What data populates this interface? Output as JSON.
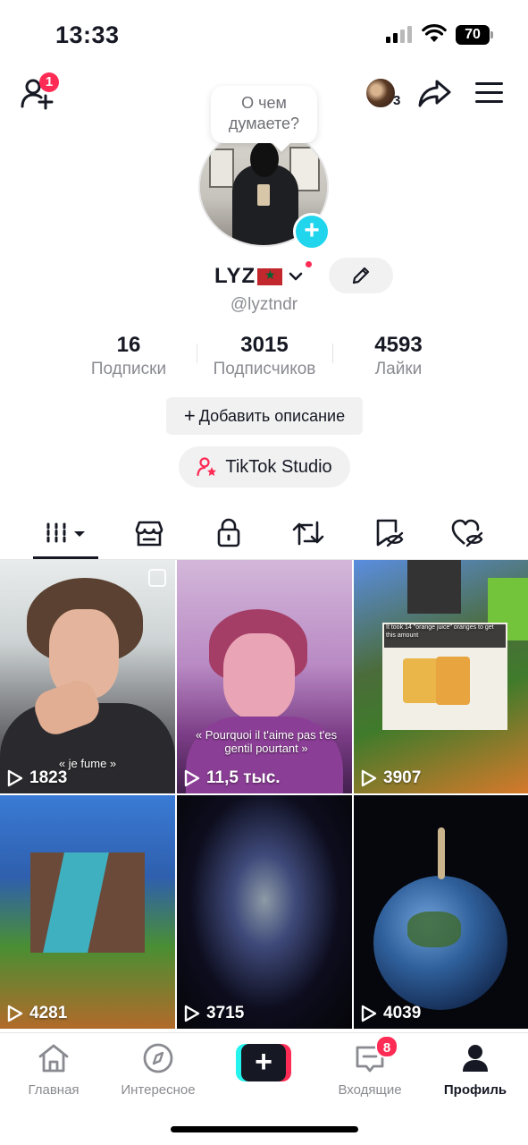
{
  "status_bar": {
    "time": "13:33",
    "battery": "70"
  },
  "top_bar": {
    "friend_requests_badge": "1",
    "visitors_count": "3"
  },
  "profile": {
    "thought_bubble": "О чем думаете?",
    "name": "LYZ",
    "username": "@lyztndr",
    "stats": [
      {
        "value": "16",
        "label": "Подписки"
      },
      {
        "value": "3015",
        "label": "Подписчиков"
      },
      {
        "value": "4593",
        "label": "Лайки"
      }
    ],
    "add_description_label": "Добавить описание",
    "studio_label": "TikTok Studio"
  },
  "tabs": [
    {
      "icon": "grid-icon",
      "active": true
    },
    {
      "icon": "shop-icon"
    },
    {
      "icon": "lock-icon"
    },
    {
      "icon": "repost-icon"
    },
    {
      "icon": "bookmark-hidden-icon"
    },
    {
      "icon": "liked-hidden-icon"
    }
  ],
  "videos": [
    {
      "views": "1823",
      "caption": "« je fume »"
    },
    {
      "views": "11,5 тыс.",
      "caption": "« Pourquoi il t'aime pas t'es gentil pourtant »"
    },
    {
      "views": "3907",
      "caption": "It took 14 \"orange juice\" oranges to get this amount"
    },
    {
      "views": "4281",
      "caption": ""
    },
    {
      "views": "3715",
      "caption": ""
    },
    {
      "views": "4039",
      "caption": ""
    }
  ],
  "bottom_nav": {
    "items": [
      {
        "label": "Главная",
        "icon": "home-icon"
      },
      {
        "label": "Интересное",
        "icon": "compass-icon"
      },
      {
        "label": "Входящие",
        "icon": "inbox-icon"
      },
      {
        "label": "Профиль",
        "icon": "profile-icon",
        "active": true
      }
    ],
    "inbox_badge": "8"
  },
  "colors": {
    "accent_red": "#fe2c55",
    "accent_cyan": "#20d5ec",
    "text_primary": "#161823",
    "text_secondary": "#8a8b91"
  }
}
